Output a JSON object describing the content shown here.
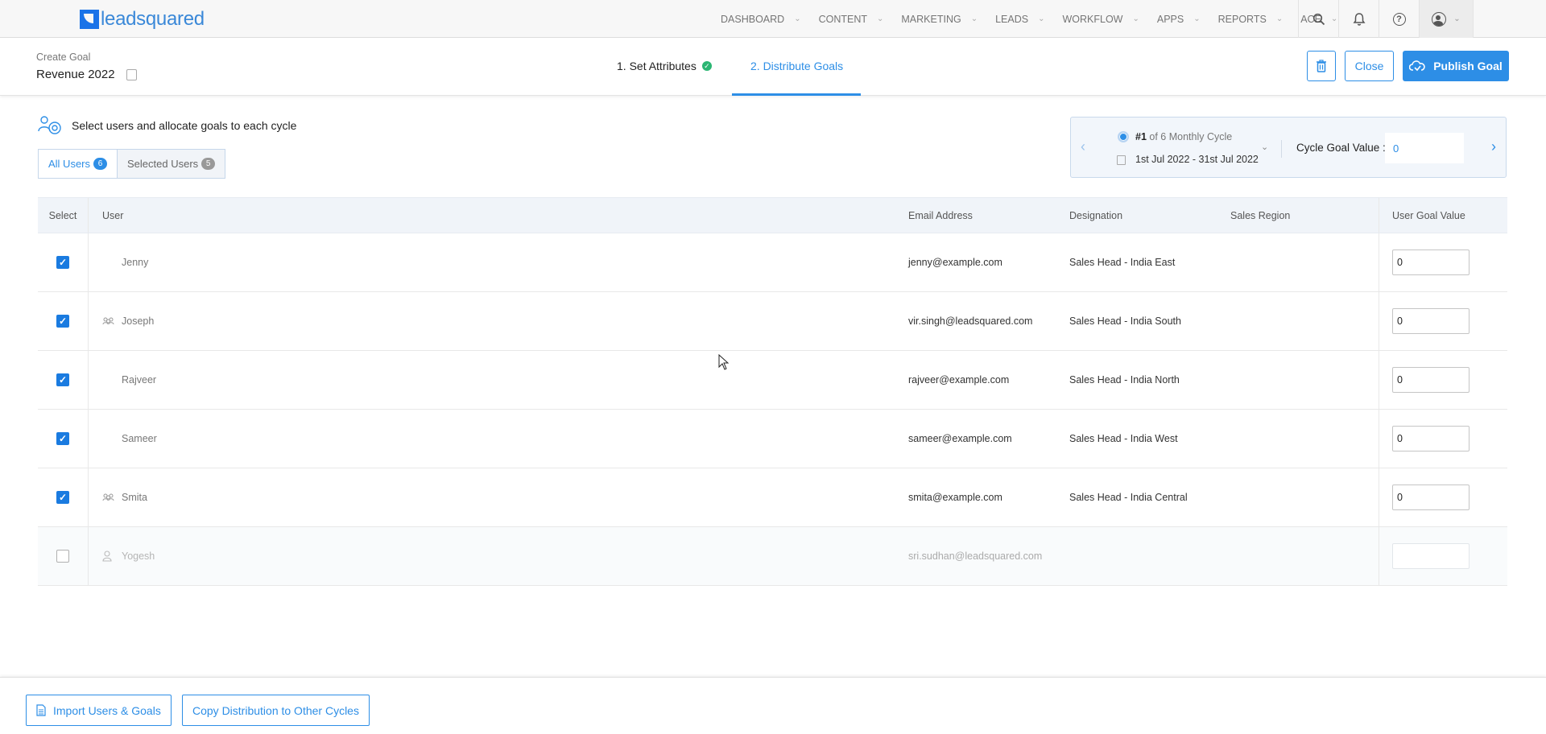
{
  "brand": {
    "logo_text": "leadsquared",
    "accent": "#2d8ee6"
  },
  "nav": {
    "items": [
      "DASHBOARD",
      "CONTENT",
      "MARKETING",
      "LEADS",
      "WORKFLOW",
      "APPS",
      "REPORTS",
      "ACE"
    ],
    "icons": [
      "search-icon",
      "bell-icon",
      "help-icon",
      "user-icon"
    ]
  },
  "header": {
    "breadcrumb": "Create Goal",
    "goal_name": "Revenue 2022",
    "step1": "1. Set Attributes",
    "step2": "2. Distribute Goals",
    "close_label": "Close",
    "publish_label": "Publish Goal"
  },
  "content": {
    "instruction": "Select users and allocate goals to each cycle",
    "tab_all": "All Users",
    "tab_all_count": "6",
    "tab_selected": "Selected Users",
    "tab_selected_count": "5"
  },
  "cycle": {
    "index": "#1",
    "name_suffix": " of 6 Monthly Cycle",
    "dates": "1st Jul 2022 - 31st Jul 2022",
    "goal_label": "Cycle Goal Value :",
    "goal_value": "0"
  },
  "table": {
    "headers": {
      "select": "Select",
      "user": "User",
      "email": "Email Address",
      "designation": "Designation",
      "region": "Sales Region",
      "goal": "User Goal Value"
    },
    "rows": [
      {
        "name": "Jenny",
        "email": "jenny@example.com",
        "designation": "Sales Head - India East",
        "region": "",
        "goal": "0",
        "checked": true,
        "icon": ""
      },
      {
        "name": "Joseph",
        "email": "vir.singh@leadsquared.com",
        "designation": "Sales Head - India South",
        "region": "",
        "goal": "0",
        "checked": true,
        "icon": "team-icon"
      },
      {
        "name": "Rajveer",
        "email": "rajveer@example.com",
        "designation": "Sales Head - India North",
        "region": "",
        "goal": "0",
        "checked": true,
        "icon": ""
      },
      {
        "name": "Sameer",
        "email": "sameer@example.com",
        "designation": "Sales Head - India West",
        "region": "",
        "goal": "0",
        "checked": true,
        "icon": ""
      },
      {
        "name": "Smita",
        "email": "smita@example.com",
        "designation": "Sales Head - India Central",
        "region": "",
        "goal": "0",
        "checked": true,
        "icon": "team-icon"
      },
      {
        "name": "Yogesh",
        "email": "sri.sudhan@leadsquared.com",
        "designation": "",
        "region": "",
        "goal": "",
        "checked": false,
        "icon": "person-icon"
      }
    ]
  },
  "footer": {
    "import_label": "Import Users & Goals",
    "copy_label": "Copy Distribution to Other Cycles"
  }
}
